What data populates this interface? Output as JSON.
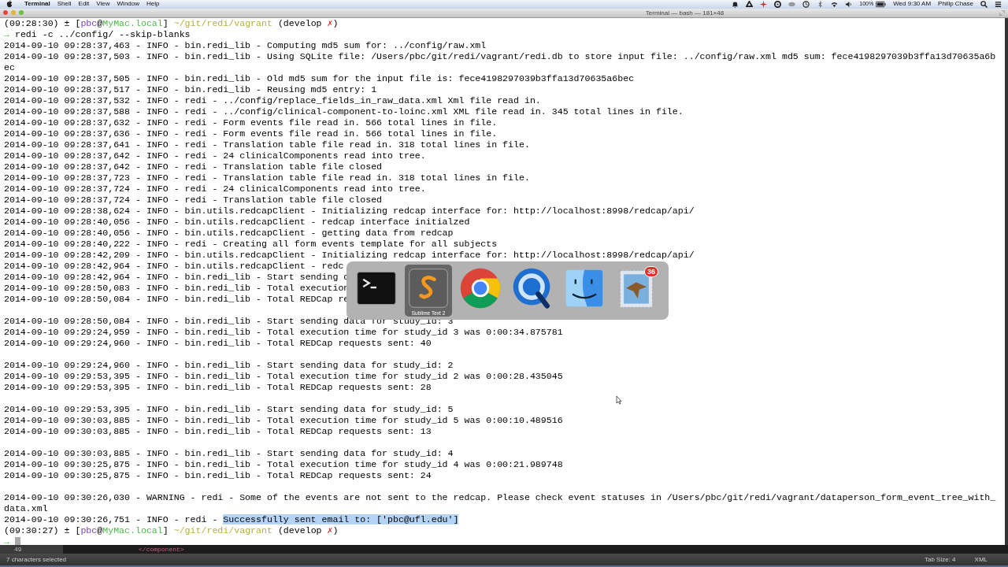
{
  "menu_bar": {
    "app": "Terminal",
    "items": [
      "Shell",
      "Edit",
      "View",
      "Window",
      "Help"
    ],
    "battery": "100%",
    "clock": "Wed 9:30 AM",
    "user": "Philip Chase"
  },
  "window": {
    "title": "Terminal — bash — 181×48"
  },
  "terminal": {
    "lines": [
      {
        "kind": "prompt",
        "segments": [
          {
            "text": "(09:28:30) ± [",
            "kind": "plain"
          },
          {
            "text": "pbc",
            "kind": "user"
          },
          {
            "text": "@",
            "kind": "plain"
          },
          {
            "text": "MyMac.local",
            "kind": "host"
          },
          {
            "text": "] ",
            "kind": "plain"
          },
          {
            "text": "~/git/redi/vagrant",
            "kind": "path"
          },
          {
            "text": " (develop ",
            "kind": "plain"
          },
          {
            "text": "✗",
            "kind": "dirty"
          },
          {
            "text": ")",
            "kind": "plain"
          }
        ]
      },
      {
        "kind": "command",
        "arrow": "→",
        "text": " redi -c ../config/ --skip-blanks"
      },
      {
        "kind": "log",
        "text": "2014-09-10 09:28:37,463 - INFO - bin.redi_lib - Computing md5 sum for: ../config/raw.xml"
      },
      {
        "kind": "log",
        "text": "2014-09-10 09:28:37,503 - INFO - bin.redi_lib - Using SQLite file: /Users/pbc/git/redi/vagrant/redi.db to store input file: ../config/raw.xml md5 sum: fece4198297039b3ffa13d70635a6b"
      },
      {
        "kind": "log",
        "text": "ec"
      },
      {
        "kind": "log",
        "text": "2014-09-10 09:28:37,505 - INFO - bin.redi_lib - Old md5 sum for the input file is: fece4198297039b3ffa13d70635a6bec"
      },
      {
        "kind": "log",
        "text": "2014-09-10 09:28:37,517 - INFO - bin.redi_lib - Reusing md5 entry: 1"
      },
      {
        "kind": "log",
        "text": "2014-09-10 09:28:37,532 - INFO - redi - ../config/replace_fields_in_raw_data.xml Xml file read in."
      },
      {
        "kind": "log",
        "text": "2014-09-10 09:28:37,588 - INFO - redi - ../config/clinical-component-to-loinc.xml XML file read in. 345 total lines in file."
      },
      {
        "kind": "log",
        "text": "2014-09-10 09:28:37,632 - INFO - redi - Form events file read in. 566 total lines in file."
      },
      {
        "kind": "log",
        "text": "2014-09-10 09:28:37,636 - INFO - redi - Form events file read in. 566 total lines in file."
      },
      {
        "kind": "log",
        "text": "2014-09-10 09:28:37,641 - INFO - redi - Translation table file read in. 318 total lines in file."
      },
      {
        "kind": "log",
        "text": "2014-09-10 09:28:37,642 - INFO - redi - 24 clinicalComponents read into tree."
      },
      {
        "kind": "log",
        "text": "2014-09-10 09:28:37,642 - INFO - redi - Translation table file closed"
      },
      {
        "kind": "log",
        "text": "2014-09-10 09:28:37,723 - INFO - redi - Translation table file read in. 318 total lines in file."
      },
      {
        "kind": "log",
        "text": "2014-09-10 09:28:37,724 - INFO - redi - 24 clinicalComponents read into tree."
      },
      {
        "kind": "log",
        "text": "2014-09-10 09:28:37,724 - INFO - redi - Translation table file closed"
      },
      {
        "kind": "log",
        "text": "2014-09-10 09:28:38,624 - INFO - bin.utils.redcapClient - Initializing redcap interface for: http://localhost:8998/redcap/api/"
      },
      {
        "kind": "log",
        "text": "2014-09-10 09:28:40,056 - INFO - bin.utils.redcapClient - redcap interface initialzed"
      },
      {
        "kind": "log",
        "text": "2014-09-10 09:28:40,056 - INFO - bin.utils.redcapClient - getting data from redcap"
      },
      {
        "kind": "log",
        "text": "2014-09-10 09:28:40,222 - INFO - redi - Creating all form events template for all subjects"
      },
      {
        "kind": "log",
        "text": "2014-09-10 09:28:42,209 - INFO - bin.utils.redcapClient - Initializing redcap interface for: http://localhost:8998/redcap/api/"
      },
      {
        "kind": "log",
        "text": "2014-09-10 09:28:42,964 - INFO - bin.utils.redcapClient - redc"
      },
      {
        "kind": "log",
        "text": "2014-09-10 09:28:42,964 - INFO - bin.redi_lib - Start sending d"
      },
      {
        "kind": "log",
        "text": "2014-09-10 09:28:50,083 - INFO - bin.redi_lib - Total execution"
      },
      {
        "kind": "log",
        "text": "2014-09-10 09:28:50,084 - INFO - bin.redi_lib - Total REDCap re"
      },
      {
        "kind": "blank"
      },
      {
        "kind": "log",
        "text": "2014-09-10 09:28:50,084 - INFO - bin.redi_lib - Start sending data for study_id: 3"
      },
      {
        "kind": "log",
        "text": "2014-09-10 09:29:24,959 - INFO - bin.redi_lib - Total execution time for study_id 3 was 0:00:34.875781"
      },
      {
        "kind": "log",
        "text": "2014-09-10 09:29:24,960 - INFO - bin.redi_lib - Total REDCap requests sent: 40"
      },
      {
        "kind": "blank"
      },
      {
        "kind": "log",
        "text": "2014-09-10 09:29:24,960 - INFO - bin.redi_lib - Start sending data for study_id: 2"
      },
      {
        "kind": "log",
        "text": "2014-09-10 09:29:53,395 - INFO - bin.redi_lib - Total execution time for study_id 2 was 0:00:28.435045"
      },
      {
        "kind": "log",
        "text": "2014-09-10 09:29:53,395 - INFO - bin.redi_lib - Total REDCap requests sent: 28"
      },
      {
        "kind": "blank"
      },
      {
        "kind": "log",
        "text": "2014-09-10 09:29:53,395 - INFO - bin.redi_lib - Start sending data for study_id: 5"
      },
      {
        "kind": "log",
        "text": "2014-09-10 09:30:03,885 - INFO - bin.redi_lib - Total execution time for study_id 5 was 0:00:10.489516"
      },
      {
        "kind": "log",
        "text": "2014-09-10 09:30:03,885 - INFO - bin.redi_lib - Total REDCap requests sent: 13"
      },
      {
        "kind": "blank"
      },
      {
        "kind": "log",
        "text": "2014-09-10 09:30:03,885 - INFO - bin.redi_lib - Start sending data for study_id: 4"
      },
      {
        "kind": "log",
        "text": "2014-09-10 09:30:25,875 - INFO - bin.redi_lib - Total execution time for study_id 4 was 0:00:21.989748"
      },
      {
        "kind": "log",
        "text": "2014-09-10 09:30:25,875 - INFO - bin.redi_lib - Total REDCap requests sent: 24"
      },
      {
        "kind": "blank"
      },
      {
        "kind": "log",
        "text": "2014-09-10 09:30:26,030 - WARNING - redi - Some of the events are not sent to the redcap. Please check event statuses in /Users/pbc/git/redi/vagrant/dataperson_form_event_tree_with_"
      },
      {
        "kind": "log",
        "text": "data.xml"
      },
      {
        "kind": "log",
        "text": "2014-09-10 09:30:26,751 - INFO - redi - ",
        "selection": "Successfully sent email to: ['pbc@ufl.edu']"
      },
      {
        "kind": "prompt",
        "segments": [
          {
            "text": "(09:30:27) ± [",
            "kind": "plain"
          },
          {
            "text": "pbc",
            "kind": "user"
          },
          {
            "text": "@",
            "kind": "plain"
          },
          {
            "text": "MyMac.local",
            "kind": "host"
          },
          {
            "text": "] ",
            "kind": "plain"
          },
          {
            "text": "~/git/redi/vagrant",
            "kind": "path"
          },
          {
            "text": " (develop ",
            "kind": "plain"
          },
          {
            "text": "✗",
            "kind": "dirty"
          },
          {
            "text": ")",
            "kind": "plain"
          }
        ]
      },
      {
        "kind": "input",
        "arrow": "→"
      }
    ]
  },
  "app_switcher": {
    "apps": [
      {
        "kind": "terminal",
        "selected": false
      },
      {
        "kind": "sublime",
        "selected": true,
        "label": "Sublime Text 2"
      },
      {
        "kind": "chrome",
        "selected": false
      },
      {
        "kind": "quicktime",
        "selected": false
      },
      {
        "kind": "finder",
        "selected": false
      },
      {
        "kind": "mail",
        "selected": false,
        "badge": "36"
      }
    ]
  },
  "editor_behind": {
    "line_number": "49",
    "code": "</component>"
  },
  "status_bar": {
    "left": "7 characters selected",
    "tab_size": "Tab Size: 4",
    "syntax": "XML"
  }
}
